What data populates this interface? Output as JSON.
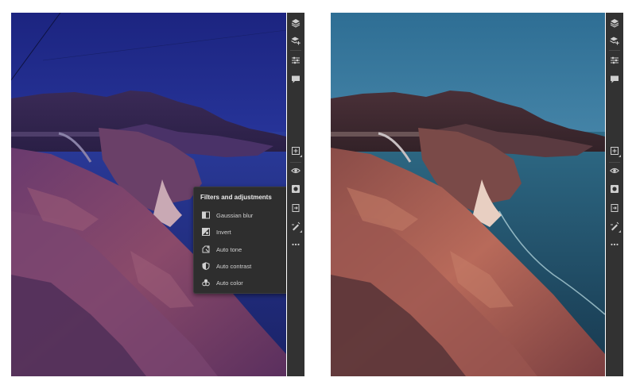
{
  "filters_menu": {
    "title": "Filters and adjustments",
    "items": [
      {
        "label": "Gaussian blur",
        "icon": "gaussian-blur-icon"
      },
      {
        "label": "Invert",
        "icon": "invert-icon"
      },
      {
        "label": "Auto tone",
        "icon": "auto-tone-icon"
      },
      {
        "label": "Auto contrast",
        "icon": "auto-contrast-icon"
      },
      {
        "label": "Auto color",
        "icon": "auto-color-icon"
      }
    ]
  },
  "toolbar": {
    "top_tools": [
      "layers-icon",
      "add-layer-stack-icon",
      "properties-sliders-icon",
      "comments-icon"
    ],
    "bottom_tools": [
      "add-layer-icon",
      "visibility-eye-icon",
      "mask-icon",
      "fill-layer-icon",
      "filters-adjustments-icon",
      "more-options-icon"
    ]
  },
  "colors": {
    "toolbar_bg": "#323232",
    "menu_bg": "#2e2e2e",
    "left_sky_top": "#1f2a8a",
    "right_sky_top": "#2f6f95"
  }
}
